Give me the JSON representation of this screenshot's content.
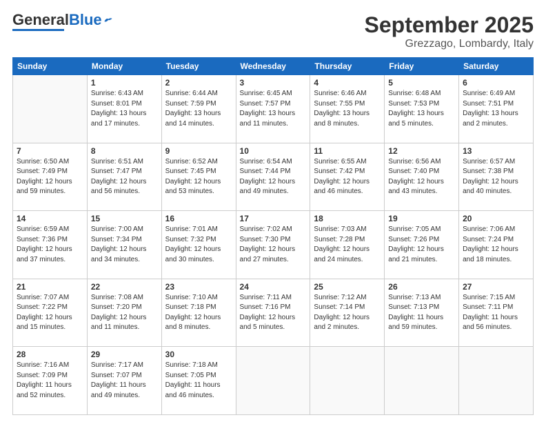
{
  "logo": {
    "general": "General",
    "blue": "Blue"
  },
  "title": "September 2025",
  "subtitle": "Grezzago, Lombardy, Italy",
  "weekdays": [
    "Sunday",
    "Monday",
    "Tuesday",
    "Wednesday",
    "Thursday",
    "Friday",
    "Saturday"
  ],
  "weeks": [
    [
      {
        "day": "",
        "info": ""
      },
      {
        "day": "1",
        "info": "Sunrise: 6:43 AM\nSunset: 8:01 PM\nDaylight: 13 hours\nand 17 minutes."
      },
      {
        "day": "2",
        "info": "Sunrise: 6:44 AM\nSunset: 7:59 PM\nDaylight: 13 hours\nand 14 minutes."
      },
      {
        "day": "3",
        "info": "Sunrise: 6:45 AM\nSunset: 7:57 PM\nDaylight: 13 hours\nand 11 minutes."
      },
      {
        "day": "4",
        "info": "Sunrise: 6:46 AM\nSunset: 7:55 PM\nDaylight: 13 hours\nand 8 minutes."
      },
      {
        "day": "5",
        "info": "Sunrise: 6:48 AM\nSunset: 7:53 PM\nDaylight: 13 hours\nand 5 minutes."
      },
      {
        "day": "6",
        "info": "Sunrise: 6:49 AM\nSunset: 7:51 PM\nDaylight: 13 hours\nand 2 minutes."
      }
    ],
    [
      {
        "day": "7",
        "info": "Sunrise: 6:50 AM\nSunset: 7:49 PM\nDaylight: 12 hours\nand 59 minutes."
      },
      {
        "day": "8",
        "info": "Sunrise: 6:51 AM\nSunset: 7:47 PM\nDaylight: 12 hours\nand 56 minutes."
      },
      {
        "day": "9",
        "info": "Sunrise: 6:52 AM\nSunset: 7:45 PM\nDaylight: 12 hours\nand 53 minutes."
      },
      {
        "day": "10",
        "info": "Sunrise: 6:54 AM\nSunset: 7:44 PM\nDaylight: 12 hours\nand 49 minutes."
      },
      {
        "day": "11",
        "info": "Sunrise: 6:55 AM\nSunset: 7:42 PM\nDaylight: 12 hours\nand 46 minutes."
      },
      {
        "day": "12",
        "info": "Sunrise: 6:56 AM\nSunset: 7:40 PM\nDaylight: 12 hours\nand 43 minutes."
      },
      {
        "day": "13",
        "info": "Sunrise: 6:57 AM\nSunset: 7:38 PM\nDaylight: 12 hours\nand 40 minutes."
      }
    ],
    [
      {
        "day": "14",
        "info": "Sunrise: 6:59 AM\nSunset: 7:36 PM\nDaylight: 12 hours\nand 37 minutes."
      },
      {
        "day": "15",
        "info": "Sunrise: 7:00 AM\nSunset: 7:34 PM\nDaylight: 12 hours\nand 34 minutes."
      },
      {
        "day": "16",
        "info": "Sunrise: 7:01 AM\nSunset: 7:32 PM\nDaylight: 12 hours\nand 30 minutes."
      },
      {
        "day": "17",
        "info": "Sunrise: 7:02 AM\nSunset: 7:30 PM\nDaylight: 12 hours\nand 27 minutes."
      },
      {
        "day": "18",
        "info": "Sunrise: 7:03 AM\nSunset: 7:28 PM\nDaylight: 12 hours\nand 24 minutes."
      },
      {
        "day": "19",
        "info": "Sunrise: 7:05 AM\nSunset: 7:26 PM\nDaylight: 12 hours\nand 21 minutes."
      },
      {
        "day": "20",
        "info": "Sunrise: 7:06 AM\nSunset: 7:24 PM\nDaylight: 12 hours\nand 18 minutes."
      }
    ],
    [
      {
        "day": "21",
        "info": "Sunrise: 7:07 AM\nSunset: 7:22 PM\nDaylight: 12 hours\nand 15 minutes."
      },
      {
        "day": "22",
        "info": "Sunrise: 7:08 AM\nSunset: 7:20 PM\nDaylight: 12 hours\nand 11 minutes."
      },
      {
        "day": "23",
        "info": "Sunrise: 7:10 AM\nSunset: 7:18 PM\nDaylight: 12 hours\nand 8 minutes."
      },
      {
        "day": "24",
        "info": "Sunrise: 7:11 AM\nSunset: 7:16 PM\nDaylight: 12 hours\nand 5 minutes."
      },
      {
        "day": "25",
        "info": "Sunrise: 7:12 AM\nSunset: 7:14 PM\nDaylight: 12 hours\nand 2 minutes."
      },
      {
        "day": "26",
        "info": "Sunrise: 7:13 AM\nSunset: 7:13 PM\nDaylight: 11 hours\nand 59 minutes."
      },
      {
        "day": "27",
        "info": "Sunrise: 7:15 AM\nSunset: 7:11 PM\nDaylight: 11 hours\nand 56 minutes."
      }
    ],
    [
      {
        "day": "28",
        "info": "Sunrise: 7:16 AM\nSunset: 7:09 PM\nDaylight: 11 hours\nand 52 minutes."
      },
      {
        "day": "29",
        "info": "Sunrise: 7:17 AM\nSunset: 7:07 PM\nDaylight: 11 hours\nand 49 minutes."
      },
      {
        "day": "30",
        "info": "Sunrise: 7:18 AM\nSunset: 7:05 PM\nDaylight: 11 hours\nand 46 minutes."
      },
      {
        "day": "",
        "info": ""
      },
      {
        "day": "",
        "info": ""
      },
      {
        "day": "",
        "info": ""
      },
      {
        "day": "",
        "info": ""
      }
    ]
  ]
}
